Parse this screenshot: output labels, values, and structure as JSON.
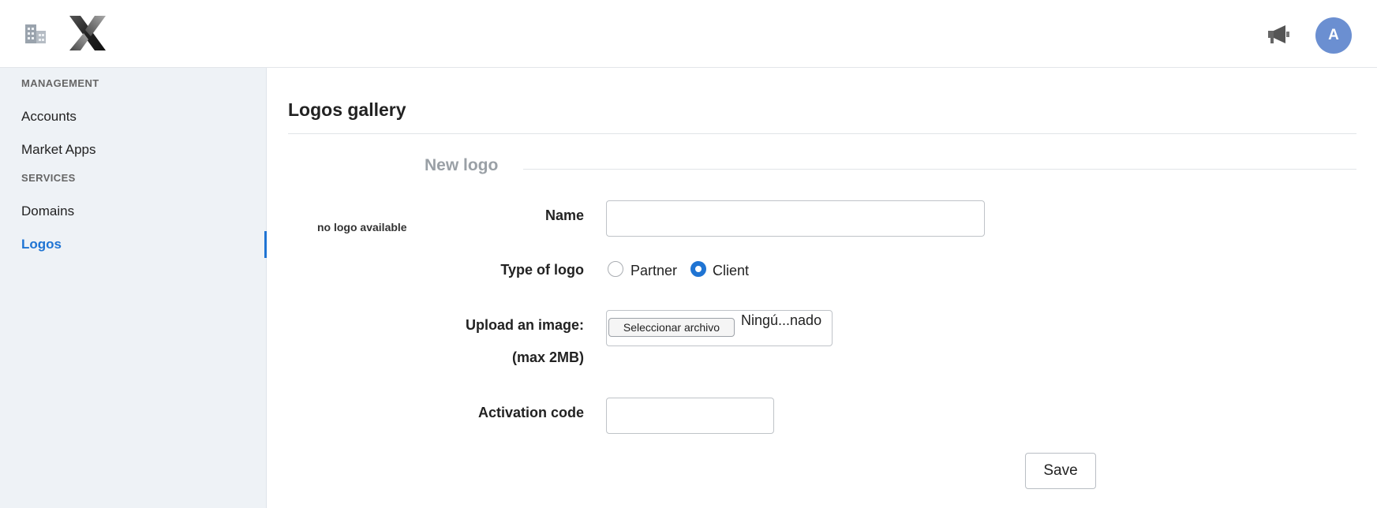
{
  "header": {
    "left_icon": "building-icon",
    "logo": "x-logo",
    "notifications_icon": "megaphone-icon",
    "avatar_initial": "A",
    "avatar_color": "#6b8fd1"
  },
  "sidebar": {
    "sections": [
      {
        "title": "MANAGEMENT",
        "items": [
          {
            "label": "Accounts"
          },
          {
            "label": "Market Apps"
          }
        ]
      },
      {
        "title": "SERVICES",
        "items": [
          {
            "label": "Domains"
          },
          {
            "label": "Logos"
          }
        ]
      }
    ],
    "active_item": "Logos",
    "accent_color": "#1f74d3"
  },
  "main": {
    "title": "Logos gallery",
    "legend": "New logo",
    "preview_text": "no logo available",
    "form": {
      "name_label": "Name",
      "name_value": "",
      "type_label": "Type of logo",
      "type_options": [
        {
          "label": "Partner",
          "checked": false
        },
        {
          "label": "Client",
          "checked": true
        }
      ],
      "upload_label": "Upload an image:",
      "upload_hint": "(max 2MB)",
      "file_button": "Seleccionar archivo",
      "file_name": "Ningú...nado",
      "activation_label": "Activation code",
      "activation_value": "",
      "save_label": "Save"
    }
  }
}
